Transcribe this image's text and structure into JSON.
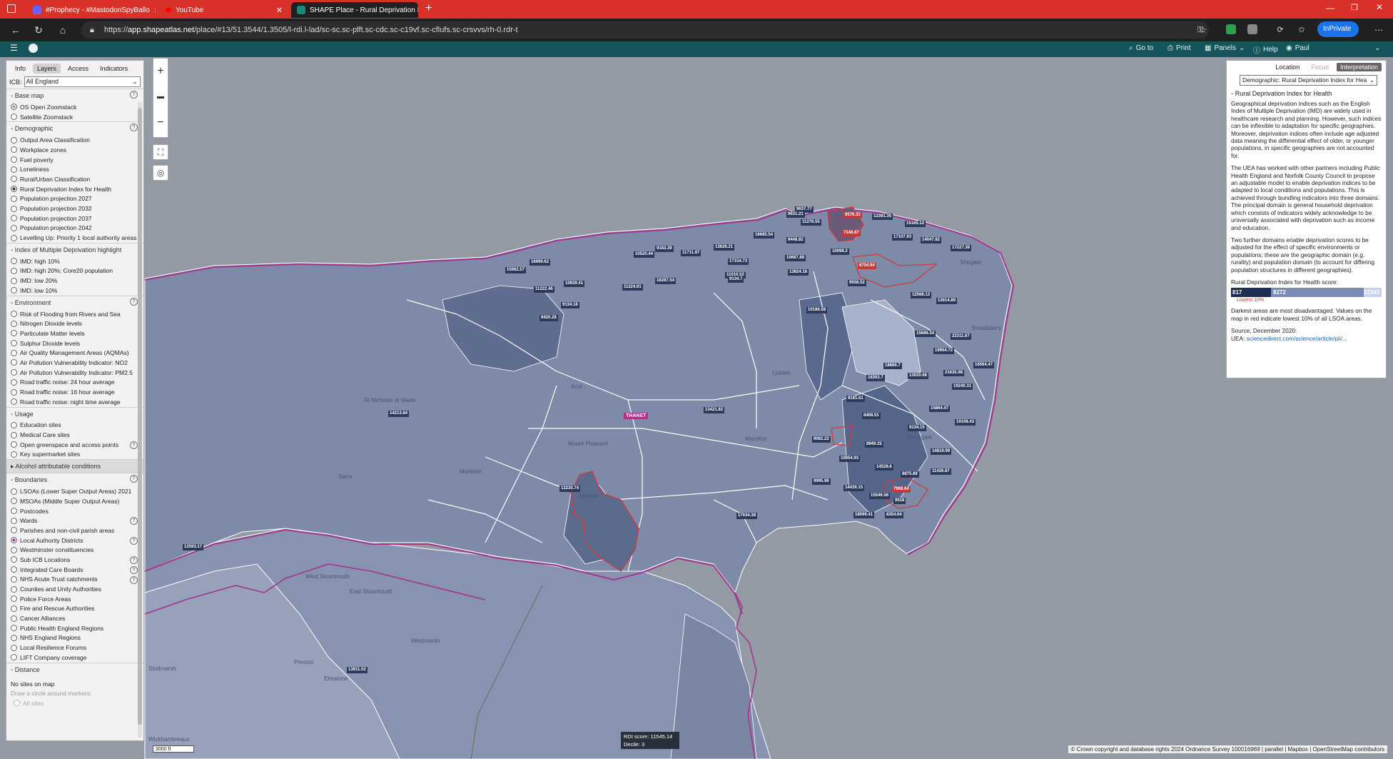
{
  "browser": {
    "tabs": [
      {
        "title": "#Prophecy - #MastodonSpyBallo",
        "active": false
      },
      {
        "title": "YouTube",
        "active": false
      },
      {
        "title": "SHAPE Place - Rural Deprivation I",
        "active": true
      }
    ],
    "url_host": "app.shapeatlas.net",
    "url_rest": "/place/#13/51.3544/1.3505/l-rdi.l-lad/sc-sc.sc-plft.sc-cdc.sc-c19vf.sc-cflufs.sc-crsvvs/rh-0.rdr-t",
    "url_scheme": "https://",
    "inprivate": "InPrivate",
    "ext_colors": [
      "#2aa14a",
      "#888888"
    ]
  },
  "appbar": {
    "goto": "Go to",
    "print": "Print",
    "panels": "Panels",
    "help": "Help",
    "user": "Paul"
  },
  "left": {
    "tabs": [
      "Info",
      "Layers",
      "Access",
      "Indicators"
    ],
    "icb_label": "ICB:",
    "icb_value": "All England",
    "sections": [
      {
        "title": "Base map",
        "help": true,
        "items": [
          {
            "label": "OS Open Zoomstack",
            "state": "grey"
          },
          {
            "label": "Satellite Zoomstack",
            "state": "off"
          }
        ]
      },
      {
        "title": "Demographic",
        "help": true,
        "items": [
          {
            "label": "Output Area Classification",
            "state": "off"
          },
          {
            "label": "Workplace zones",
            "state": "off"
          },
          {
            "label": "Fuel poverty",
            "state": "off"
          },
          {
            "label": "Loneliness",
            "state": "off"
          },
          {
            "label": "Rural/Urban Classification",
            "state": "off"
          },
          {
            "label": "Rural Deprivation Index for Health",
            "state": "on"
          },
          {
            "label": "Population projection 2027",
            "state": "off"
          },
          {
            "label": "Population projection 2032",
            "state": "off"
          },
          {
            "label": "Population projection 2037",
            "state": "off"
          },
          {
            "label": "Population projection 2042",
            "state": "off"
          },
          {
            "label": "Levelling Up: Priority 1 local authority areas",
            "state": "off"
          }
        ]
      },
      {
        "title": "Index of Multiple Deprivation highlight",
        "help": false,
        "items": [
          {
            "label": "IMD: high 10%",
            "state": "off"
          },
          {
            "label": "IMD: high 20%; Core20 population",
            "state": "off"
          },
          {
            "label": "IMD: low 20%",
            "state": "off"
          },
          {
            "label": "IMD: low 10%",
            "state": "off"
          }
        ]
      },
      {
        "title": "Environment",
        "help": true,
        "items": [
          {
            "label": "Risk of Flooding from Rivers and Sea",
            "state": "off"
          },
          {
            "label": "Nitrogen Dioxide levels",
            "state": "off"
          },
          {
            "label": "Particulate Matter levels",
            "state": "off"
          },
          {
            "label": "Sulphur Dioxide levels",
            "state": "off"
          },
          {
            "label": "Air Quality Management Areas (AQMAs)",
            "state": "off"
          },
          {
            "label": "Air Pollution Vulnerability Indicator: NO2",
            "state": "off"
          },
          {
            "label": "Air Pollution Vulnerability Indicator: PM2.5",
            "state": "off"
          },
          {
            "label": "Road traffic noise: 24 hour average",
            "state": "off"
          },
          {
            "label": "Road traffic noise: 16 hour average",
            "state": "off"
          },
          {
            "label": "Road traffic noise: night time average",
            "state": "off"
          }
        ]
      },
      {
        "title": "Usage",
        "help": false,
        "items": [
          {
            "label": "Education sites",
            "state": "off"
          },
          {
            "label": "Medical Care sites",
            "state": "off"
          },
          {
            "label": "Open greenspace and access points",
            "state": "off",
            "help": true
          },
          {
            "label": "Key supermarket sites",
            "state": "off"
          }
        ]
      },
      {
        "title": "Alcohol attributable conditions",
        "help": false,
        "shade": true,
        "items": []
      },
      {
        "title": "Boundaries",
        "help": true,
        "items": [
          {
            "label": "LSOAs (Lower Super Output Areas) 2021",
            "state": "off"
          },
          {
            "label": "MSOAs (Middle Super Output Areas)",
            "state": "off"
          },
          {
            "label": "Postcodes",
            "state": "off"
          },
          {
            "label": "Wards",
            "state": "off",
            "help": true
          },
          {
            "label": "Parishes and non-civil parish areas",
            "state": "off"
          },
          {
            "label": "Local Authority Districts",
            "state": "pink",
            "help": true
          },
          {
            "label": "Westminster constituencies",
            "state": "off"
          },
          {
            "label": "Sub ICB Locations",
            "state": "off",
            "help": true
          },
          {
            "label": "Integrated Care Boards",
            "state": "off",
            "help": true
          },
          {
            "label": "NHS Acute Trust catchments",
            "state": "off",
            "help": true
          },
          {
            "label": "Counties and Unity Authorities",
            "state": "off"
          },
          {
            "label": "Police Force Areas",
            "state": "off"
          },
          {
            "label": "Fire and Rescue Authorities",
            "state": "off"
          },
          {
            "label": "Cancer Alliances",
            "state": "off"
          },
          {
            "label": "Public Health England Regions",
            "state": "off"
          },
          {
            "label": "NHS England Regions",
            "state": "off"
          },
          {
            "label": "Local Resilience Forums",
            "state": "off"
          },
          {
            "label": "LIFT Company coverage",
            "state": "off"
          }
        ]
      },
      {
        "title": "Distance",
        "help": false,
        "items": []
      }
    ],
    "distance_nosites": "No sites on map",
    "distance_hint": "Draw a circle around markers:",
    "distance_all": "All sites"
  },
  "right": {
    "tabs": [
      "Location",
      "Focus",
      "Interpretation"
    ],
    "select": "Demographic: Rural Deprivation Index for Hea",
    "heading": "Rural Deprivation Index for Health",
    "paragraphs": [
      "Geographical deprivation indices such as the English Index of Multiple Deprivation (IMD) are widely used in healthcare research and planning. However, such indices can be inflexible to adaptation for specific geographies. Moreover, deprivation indices often include age adjusted data meaning the differential effect of older, or younger populations, in specific geographies are not accounted for.",
      "The UEA has worked with other partners including Public Health England and Norfolk County Council to propose an adjustable model to enable deprivation indices to be adapted to local conditions and populations. This is achieved through bundling indicators into three domains. The principal domain is general household deprivation which consists of indicators widely acknowledge to be universally associated with deprivation such as income and education.",
      "Two further domains enable deprivation scores to be adjusted for the effect of specific environments or populations; these are the geographic domain (e.g. rurality) and population domain (to account for differing population structures in different geographies)."
    ],
    "score_label": "Rural Deprivation Index for Health score:",
    "scale_min": "817",
    "scale_mid": "8272",
    "scale_max": "32342",
    "lowest": "Lowest 10%",
    "note": "Darkest areas are most disadvantaged. Values on the map in red indicate lowest 10% of all LSOA areas.",
    "source": "Source, December 2020:",
    "uea_label": "UEA:",
    "uea_link": "sciencedirect.com/science/article/pii/...",
    "scale_colors": [
      "#1e2d55",
      "#7a8bb8",
      "#c8d2ea"
    ]
  },
  "map": {
    "thanet": "THANET",
    "tooltip_score": "RDI score: 11545.14",
    "tooltip_decile": "Decile: 3",
    "scale": "3000 ft",
    "attribution": "© Crown copyright and database rights 2024 Ordnance Survey 100016969 | parallel | Mapbox | OpenStreetMap contributors",
    "places": [
      "St Nicholas at Wade",
      "Acol",
      "Mount Pleasant",
      "Minster",
      "Monkton",
      "Sarre",
      "Lydden",
      "Manston",
      "West Stourmouth",
      "East Stourmouth",
      "Westmarsh",
      "Preston",
      "Elmstone",
      "Stodmarsh",
      "Wickhambreaux",
      "Margate",
      "Broadstairs",
      "Ramsgate"
    ],
    "labels": [
      {
        "t": "9637.77",
        "red": false
      },
      {
        "t": "9631.21",
        "red": false
      },
      {
        "t": "11276.55",
        "red": false
      },
      {
        "t": "6576.32",
        "red": true
      },
      {
        "t": "12391.35",
        "red": false
      },
      {
        "t": "15165.12",
        "red": false
      },
      {
        "t": "7148.87",
        "red": true
      },
      {
        "t": "17107.93",
        "red": false
      },
      {
        "t": "14047.82",
        "red": false
      },
      {
        "t": "17227.36",
        "red": false
      },
      {
        "t": "16685.54",
        "red": false
      },
      {
        "t": "9448.82",
        "red": false
      },
      {
        "t": "10098.2",
        "red": false
      },
      {
        "t": "9183.39",
        "red": false
      },
      {
        "t": "13626.21",
        "red": false
      },
      {
        "t": "10520.44",
        "red": false
      },
      {
        "t": "11711.87",
        "red": false
      },
      {
        "t": "17154.73",
        "red": false
      },
      {
        "t": "10687.88",
        "red": false
      },
      {
        "t": "6754.54",
        "red": true
      },
      {
        "t": "16999.62",
        "red": false
      },
      {
        "t": "15962.57",
        "red": false
      },
      {
        "t": "13824.16",
        "red": false
      },
      {
        "t": "9938.52",
        "red": false
      },
      {
        "t": "11010.52",
        "red": false
      },
      {
        "t": "9134.7",
        "red": false
      },
      {
        "t": "16287.54",
        "red": false
      },
      {
        "t": "10939.41",
        "red": false
      },
      {
        "t": "11222.46",
        "red": false
      },
      {
        "t": "11224.91",
        "red": false
      },
      {
        "t": "12568.12",
        "red": false
      },
      {
        "t": "12614.89",
        "red": false
      },
      {
        "t": "9134.18",
        "red": false
      },
      {
        "t": "10186.58",
        "red": false
      },
      {
        "t": "9420.28",
        "red": false
      },
      {
        "t": "15686.34",
        "red": false
      },
      {
        "t": "22311.67",
        "red": false
      },
      {
        "t": "19954.72",
        "red": false
      },
      {
        "t": "18866.7",
        "red": false
      },
      {
        "t": "16564.47",
        "red": false
      },
      {
        "t": "21635.98",
        "red": false
      },
      {
        "t": "18303.7",
        "red": false
      },
      {
        "t": "13020.66",
        "red": false
      },
      {
        "t": "19240.31",
        "red": false
      },
      {
        "t": "9191.51",
        "red": false
      },
      {
        "t": "15864.47",
        "red": false
      },
      {
        "t": "14213.84",
        "red": false
      },
      {
        "t": "13421.82",
        "red": false
      },
      {
        "t": "8408.51",
        "red": false
      },
      {
        "t": "19108.43",
        "red": false
      },
      {
        "t": "9134.15",
        "red": false
      },
      {
        "t": "9082.22",
        "red": false
      },
      {
        "t": "8949.25",
        "red": false
      },
      {
        "t": "14819.99",
        "red": false
      },
      {
        "t": "10054.93",
        "red": false
      },
      {
        "t": "14528.6",
        "red": false
      },
      {
        "t": "11426.87",
        "red": false
      },
      {
        "t": "8875.88",
        "red": false
      },
      {
        "t": "9995.96",
        "red": false
      },
      {
        "t": "14439.15",
        "red": false
      },
      {
        "t": "7968.64",
        "red": true
      },
      {
        "t": "12230.74",
        "red": false
      },
      {
        "t": "15546.56",
        "red": false
      },
      {
        "t": "9518",
        "red": false
      },
      {
        "t": "17034.38",
        "red": false
      },
      {
        "t": "18099.41",
        "red": false
      },
      {
        "t": "8354.64",
        "red": false
      },
      {
        "t": "12593.17",
        "red": false
      },
      {
        "t": "13911.02",
        "red": false
      }
    ]
  }
}
